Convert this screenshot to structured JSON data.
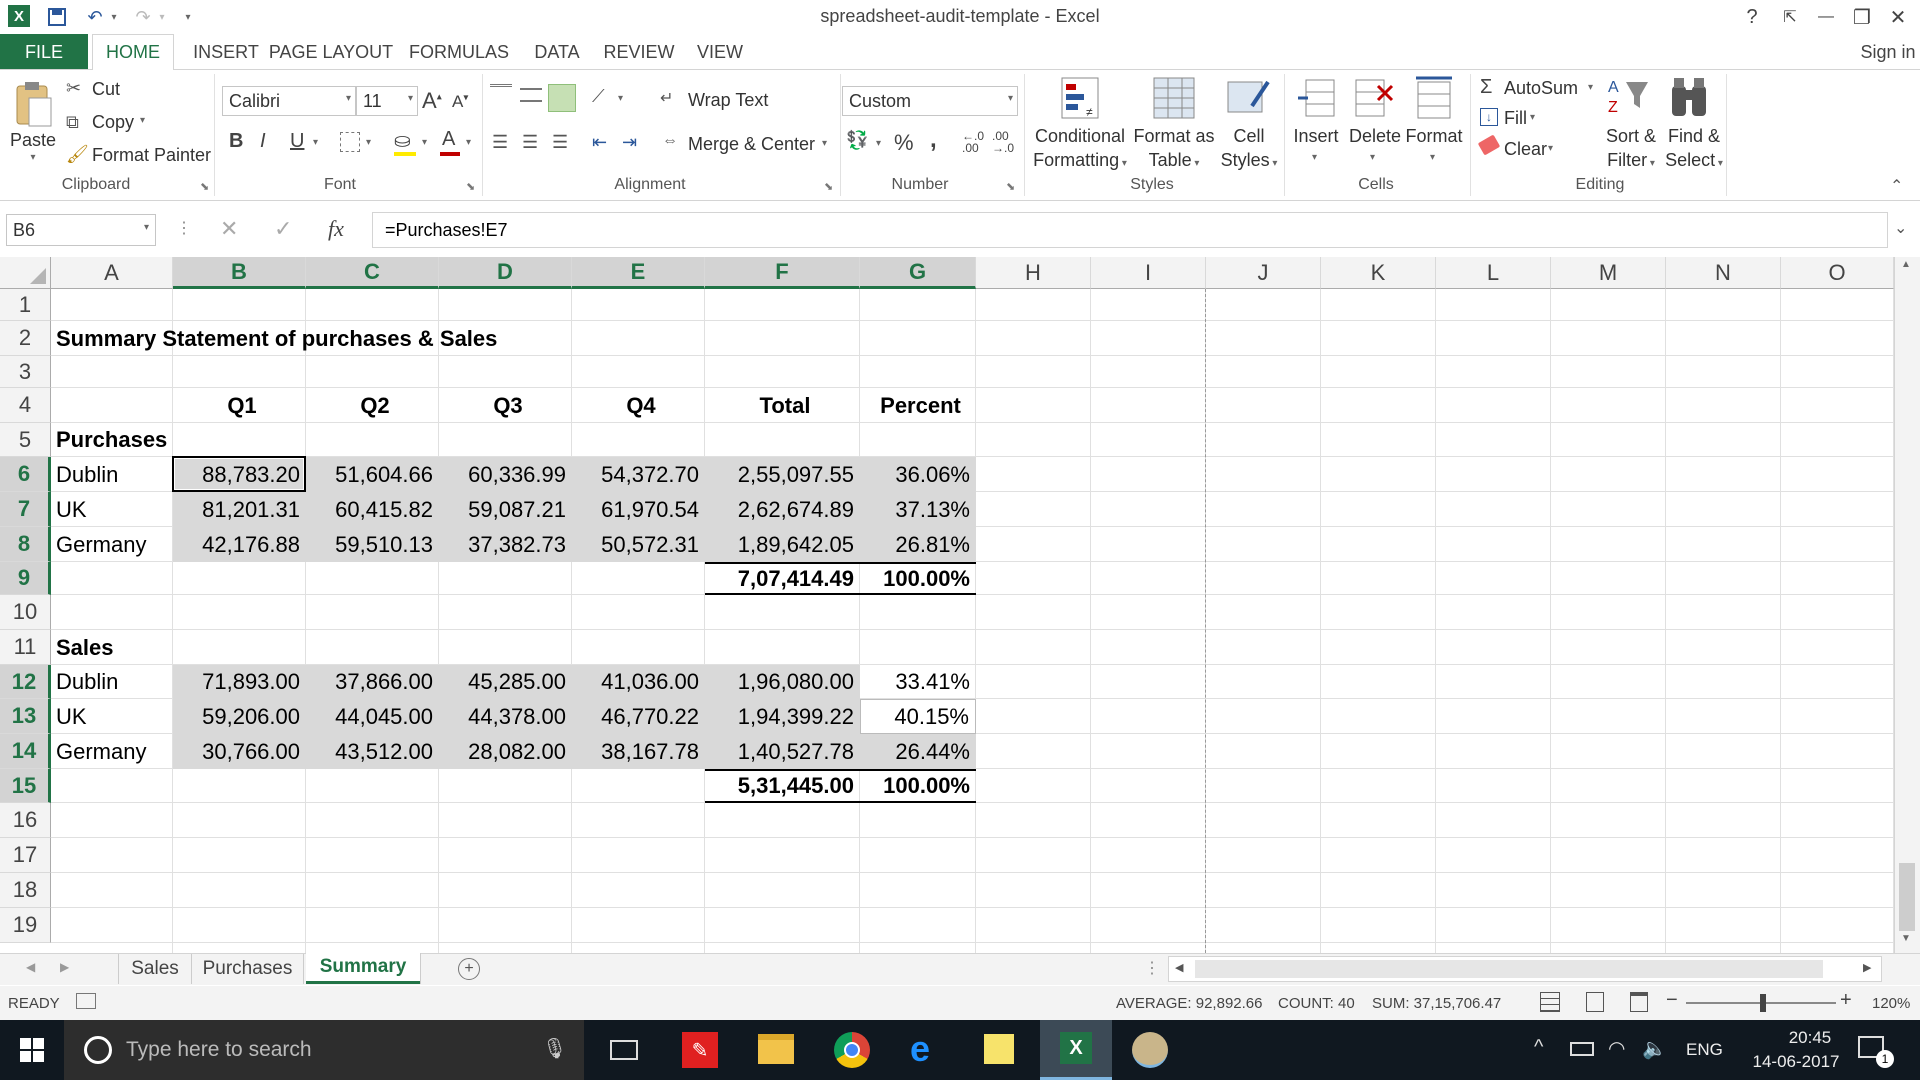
{
  "window": {
    "title": "spreadsheet-audit-template - Excel",
    "signin": "Sign in",
    "help": "?",
    "minimize": "—",
    "restore": "❐",
    "close": "✕"
  },
  "tabs": [
    "FILE",
    "HOME",
    "INSERT",
    "PAGE LAYOUT",
    "FORMULAS",
    "DATA",
    "REVIEW",
    "VIEW"
  ],
  "ribbon": {
    "clipboard": {
      "paste": "Paste",
      "cut": "Cut",
      "copy": "Copy",
      "format_painter": "Format Painter",
      "label": "Clipboard"
    },
    "font": {
      "name": "Calibri",
      "size": "11",
      "bold": "B",
      "italic": "I",
      "underline": "U",
      "label": "Font"
    },
    "alignment": {
      "wrap": "Wrap Text",
      "merge": "Merge & Center",
      "label": "Alignment"
    },
    "number": {
      "format": "Custom",
      "percent": "%",
      "comma": ",",
      "label": "Number"
    },
    "styles": {
      "conditional_1": "Conditional",
      "conditional_2": "Formatting",
      "format_table_1": "Format as",
      "format_table_2": "Table",
      "cell_styles_1": "Cell",
      "cell_styles_2": "Styles",
      "label": "Styles"
    },
    "cells": {
      "insert": "Insert",
      "delete": "Delete",
      "format": "Format",
      "label": "Cells"
    },
    "editing": {
      "autosum": "AutoSum",
      "fill": "Fill",
      "clear": "Clear",
      "sort_1": "Sort &",
      "sort_2": "Filter",
      "find_1": "Find &",
      "find_2": "Select",
      "label": "Editing"
    }
  },
  "formula_bar": {
    "name_box": "B6",
    "fx": "fx",
    "formula": "=Purchases!E7"
  },
  "columns": [
    "A",
    "B",
    "C",
    "D",
    "E",
    "F",
    "G",
    "H",
    "I",
    "J",
    "K",
    "L",
    "M",
    "N",
    "O"
  ],
  "rows": [
    "1",
    "2",
    "3",
    "4",
    "5",
    "6",
    "7",
    "8",
    "9",
    "10",
    "11",
    "12",
    "13",
    "14",
    "15",
    "16",
    "17",
    "18",
    "19"
  ],
  "sheet": {
    "title": "Summary Statement of purchases & Sales",
    "headers": [
      "Q1",
      "Q2",
      "Q3",
      "Q4",
      "Total",
      "Percent"
    ],
    "purchases_label": "Purchases",
    "purchases": [
      {
        "name": "Dublin",
        "values": [
          "88,783.20",
          "51,604.66",
          "60,336.99",
          "54,372.70",
          "2,55,097.55",
          "36.06%"
        ]
      },
      {
        "name": "UK",
        "values": [
          "81,201.31",
          "60,415.82",
          "59,087.21",
          "61,970.54",
          "2,62,674.89",
          "37.13%"
        ]
      },
      {
        "name": "Germany",
        "values": [
          "42,176.88",
          "59,510.13",
          "37,382.73",
          "50,572.31",
          "1,89,642.05",
          "26.81%"
        ]
      }
    ],
    "purchases_total": [
      "7,07,414.49",
      "100.00%"
    ],
    "sales_label": "Sales",
    "sales": [
      {
        "name": "Dublin",
        "values": [
          "71,893.00",
          "37,866.00",
          "45,285.00",
          "41,036.00",
          "1,96,080.00",
          "33.41%"
        ]
      },
      {
        "name": "UK",
        "values": [
          "59,206.00",
          "44,045.00",
          "44,378.00",
          "46,770.22",
          "1,94,399.22",
          "40.15%"
        ]
      },
      {
        "name": "Germany",
        "values": [
          "30,766.00",
          "43,512.00",
          "28,082.00",
          "38,167.78",
          "1,40,527.78",
          "26.44%"
        ]
      }
    ],
    "sales_total": [
      "5,31,445.00",
      "100.00%"
    ]
  },
  "sheet_tabs": [
    "Sales",
    "Purchases",
    "Summary"
  ],
  "active_sheet": "Summary",
  "status": {
    "ready": "READY",
    "average": "AVERAGE: 92,892.66",
    "count": "COUNT: 40",
    "sum": "SUM: 37,15,706.47",
    "zoom": "120%"
  },
  "taskbar": {
    "search_placeholder": "Type here to search",
    "lang": "ENG",
    "time": "20:45",
    "date": "14-06-2017",
    "notifications": "1"
  },
  "colors": {
    "excel_green": "#217346",
    "shade": "#d9d9d9",
    "taskbar": "#101820"
  }
}
